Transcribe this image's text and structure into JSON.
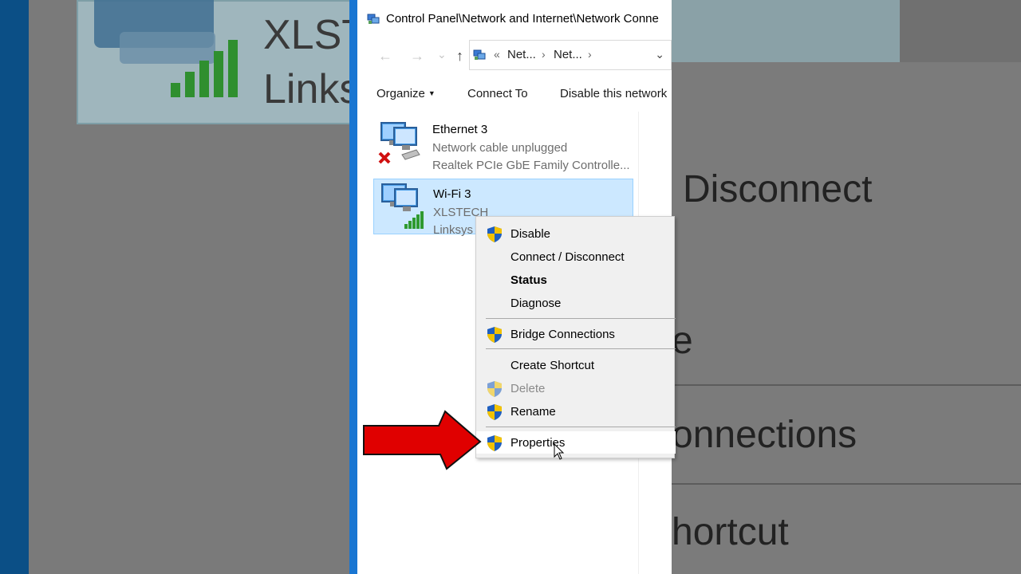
{
  "background": {
    "left_line1": "XLST",
    "left_line2": "Linksy",
    "right_lines": [
      "Disconnect",
      "e",
      "onnections",
      "hortcut"
    ]
  },
  "window": {
    "title": "Control Panel\\Network and Internet\\Network Conne",
    "nav": {
      "back_icon": "←",
      "forward_icon": "→",
      "recent_icon": "⌄",
      "up_icon": "↑",
      "breadcrumb_overflow": "«",
      "crumb1": "Net...",
      "crumb2": "Net...",
      "crumb_sep": "›",
      "dropdown_icon": "⌄"
    },
    "commands": {
      "organize": "Organize",
      "organize_arrow": "▼",
      "connect_to": "Connect To",
      "disable": "Disable this network"
    },
    "connections": [
      {
        "name": "Ethernet 3",
        "status": "Network cable unplugged",
        "device": "Realtek PCIe GbE Family Controlle..."
      },
      {
        "name": "Wi-Fi 3",
        "status": "XLSTECH",
        "device": "Linksys W"
      }
    ]
  },
  "context_menu": {
    "items": [
      {
        "label": "Disable",
        "shield": true
      },
      {
        "label": "Connect / Disconnect",
        "shield": false
      },
      {
        "label": "Status",
        "shield": false,
        "bold": true
      },
      {
        "label": "Diagnose",
        "shield": false
      },
      {
        "label": "Bridge Connections",
        "shield": true
      },
      {
        "label": "Create Shortcut",
        "shield": false
      },
      {
        "label": "Delete",
        "shield": true,
        "disabled": true
      },
      {
        "label": "Rename",
        "shield": true
      },
      {
        "label": "Properties",
        "shield": true,
        "hover": true
      }
    ]
  },
  "colors": {
    "selection_bg": "#cce8ff",
    "selection_border": "#99d1ff",
    "annotation_arrow": "#e00000",
    "shield_blue": "#1f5fbf",
    "shield_yellow": "#f2c200"
  }
}
